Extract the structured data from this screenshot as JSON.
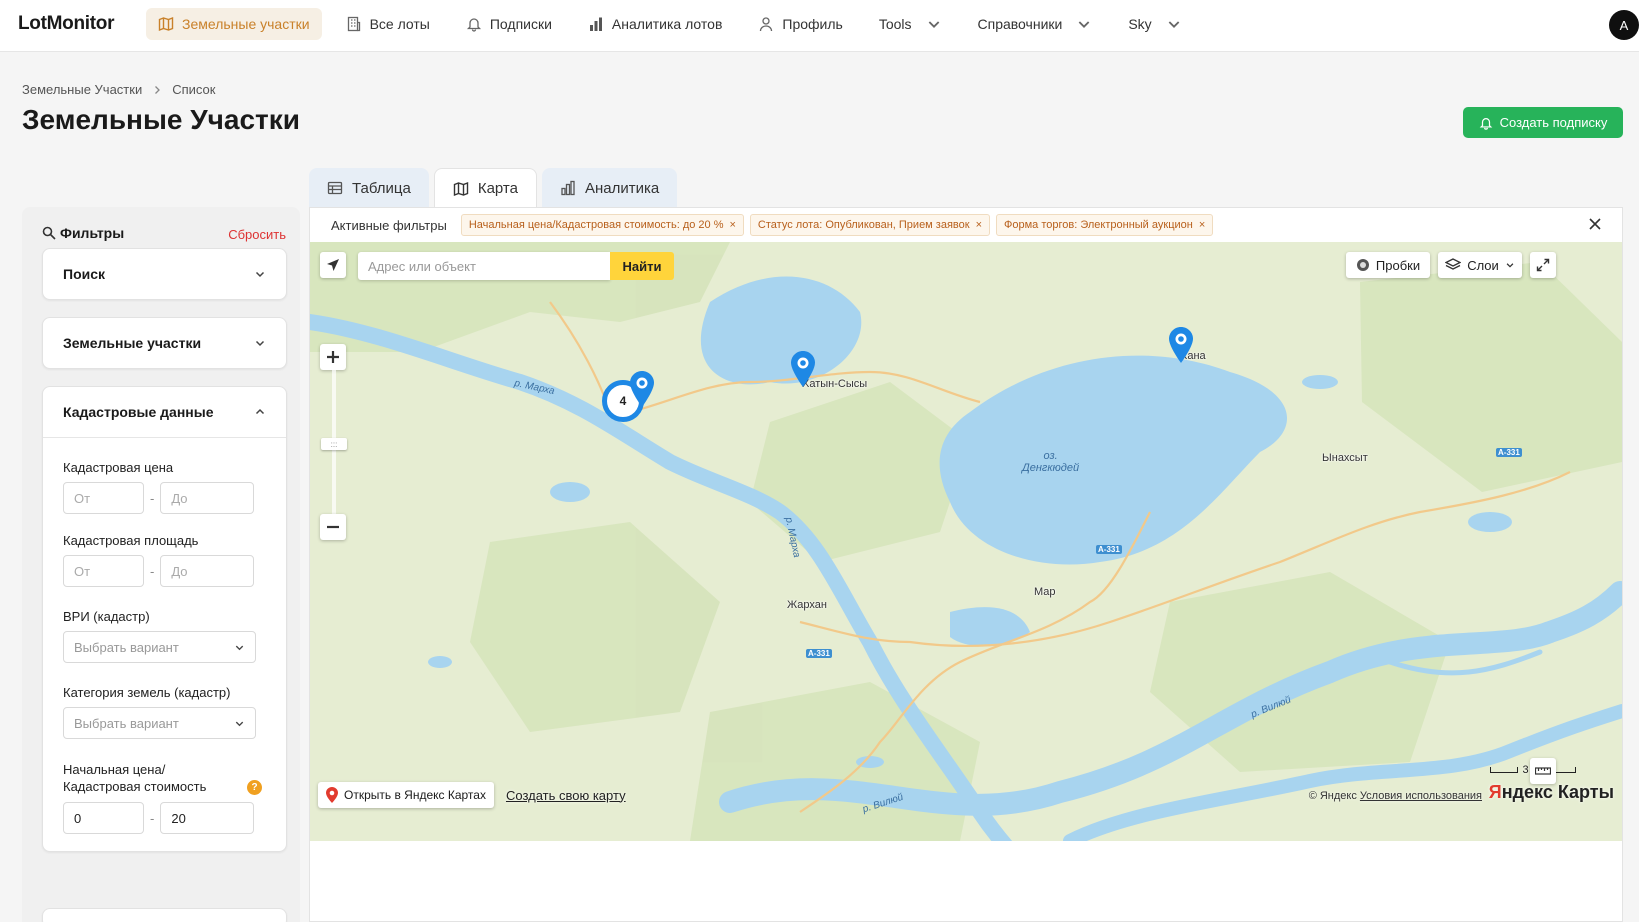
{
  "app": {
    "logo": "LotMonitor",
    "avatar_letter": "A"
  },
  "nav": {
    "items": [
      {
        "label": "Земельные участки",
        "icon": "map-icon",
        "active": true
      },
      {
        "label": "Все лоты",
        "icon": "building-icon"
      },
      {
        "label": "Подписки",
        "icon": "bell-icon"
      },
      {
        "label": "Аналитика лотов",
        "icon": "bar-chart-icon"
      },
      {
        "label": "Профиль",
        "icon": "user-icon"
      },
      {
        "label": "Tools",
        "dropdown": true
      },
      {
        "label": "Справочники",
        "dropdown": true
      },
      {
        "label": "Sky",
        "dropdown": true
      }
    ]
  },
  "breadcrumb": [
    "Земельные Участки",
    "Список"
  ],
  "page_title": "Земельные Участки",
  "create_subscription": "Создать подписку",
  "tabs": [
    {
      "label": "Таблица",
      "icon": "table-icon"
    },
    {
      "label": "Карта",
      "icon": "map-icon",
      "active": true
    },
    {
      "label": "Аналитика",
      "icon": "bar-chart-icon"
    }
  ],
  "filters": {
    "title": "Фильтры",
    "reset": "Сбросить",
    "sections": {
      "search": "Поиск",
      "land": "Земельные участки",
      "cadastral": "Кадастровые данные"
    },
    "cadastral_price": {
      "label": "Кадастровая цена",
      "from_ph": "От",
      "to_ph": "До"
    },
    "cadastral_area": {
      "label": "Кадастровая площадь",
      "from_ph": "От",
      "to_ph": "До"
    },
    "vri": {
      "label": "ВРИ (кадастр)",
      "placeholder": "Выбрать вариант"
    },
    "land_category": {
      "label": "Категория земель (кадастр)",
      "placeholder": "Выбрать вариант"
    },
    "price_ratio": {
      "label_line1": "Начальная цена/",
      "label_line2": "Кадастровая стоимость",
      "from": "0",
      "to": "20",
      "help": "?"
    }
  },
  "active_filters": {
    "label": "Активные фильтры",
    "chips": [
      "Начальная цена/Кадастровая стоимость: до 20 %",
      "Статус лота: Опубликован, Прием заявок",
      "Форма торгов: Электронный аукцион"
    ],
    "chip_close": "×"
  },
  "map": {
    "search_placeholder": "Адрес или объект",
    "search_button": "Найти",
    "traffic": "Пробки",
    "layers": "Слои",
    "cluster_count": "4",
    "places": {
      "khatyn": "Хатын-Сысы",
      "khana": "Хана",
      "ynakhsyt": "Ынахсыт",
      "zharkhan": "Жархан",
      "mar": "Мар"
    },
    "lake": {
      "line1": "оз.",
      "line2": "Денгкюдей"
    },
    "rivers": {
      "marha1": "р. Марха",
      "marha2": "р. Марха",
      "vilyuy1": "р. Вилюй",
      "vilyuy2": "р. Вилюй"
    },
    "roads": {
      "a331": "А-331"
    },
    "open_yandex": "Открыть в Яндекс Картах",
    "create_map": "Создать свою карту",
    "copyright": "© Яндекс",
    "terms": "Условия использования",
    "logo_red": "Я",
    "logo_rest": "ндекс Карты",
    "scale": "3 км"
  },
  "colors": {
    "accent": "#c9812a",
    "green": "#27b35a",
    "water": "#a8d4ef",
    "land": "#e9efd8"
  }
}
